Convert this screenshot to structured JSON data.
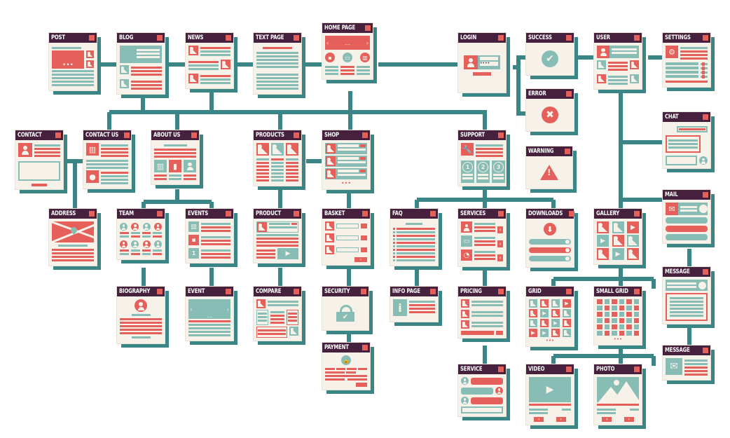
{
  "diagram": {
    "type": "website sitemap",
    "colors": {
      "connector": "#3a8585",
      "titlebar": "#46213d",
      "accent_red": "#e5605a",
      "accent_teal": "#88bdb6",
      "paper": "#f6f2e9"
    },
    "nodes": [
      {
        "id": "post",
        "title": "POST",
        "icon": "image-placeholder-icon"
      },
      {
        "id": "blog",
        "title": "BLOG",
        "icon": "image-placeholder-icon"
      },
      {
        "id": "news",
        "title": "NEWS",
        "icon": "image-placeholder-icon"
      },
      {
        "id": "text-page",
        "title": "TEXT PAGE",
        "icon": "text-lines-icon"
      },
      {
        "id": "home-page",
        "title": "HOME PAGE",
        "icon": "carousel-icon",
        "carousel_dots": "..."
      },
      {
        "id": "login",
        "title": "LOGIN",
        "icon": "user-icon",
        "password_mask": "••••"
      },
      {
        "id": "success",
        "title": "SUCCESS",
        "icon": "checkmark-icon"
      },
      {
        "id": "error",
        "title": "ERROR",
        "icon": "x-icon"
      },
      {
        "id": "user",
        "title": "USER",
        "icon": "user-icon"
      },
      {
        "id": "settings",
        "title": "SETTINGS",
        "icon": "gear-icon"
      },
      {
        "id": "chat",
        "title": "CHAT",
        "icon": "chat-bubble-icon"
      },
      {
        "id": "contact",
        "title": "CONTACT",
        "icon": "user-icon"
      },
      {
        "id": "contact-us",
        "title": "CONTACT US",
        "icon": "building-icon"
      },
      {
        "id": "about-us",
        "title": "ABOUT US",
        "icon": "chart-icon"
      },
      {
        "id": "products",
        "title": "PRODUCTS",
        "icon": "image-placeholder-icon"
      },
      {
        "id": "shop",
        "title": "SHOP",
        "icon": "image-placeholder-icon"
      },
      {
        "id": "support",
        "title": "SUPPORT",
        "icon": "wrench-icon",
        "steps": [
          "1",
          "2",
          "3"
        ]
      },
      {
        "id": "warning",
        "title": "WARNING",
        "icon": "warning-icon"
      },
      {
        "id": "mail",
        "title": "MAIL",
        "icon": "envelope-icon"
      },
      {
        "id": "address",
        "title": "ADDRESS",
        "icon": "map-pin-icon"
      },
      {
        "id": "team",
        "title": "TEAM",
        "icon": "user-icon"
      },
      {
        "id": "events",
        "title": "EVENTS",
        "icon": "calendar-icon",
        "day": "1"
      },
      {
        "id": "product",
        "title": "PRODUCT",
        "icon": "play-icon"
      },
      {
        "id": "basket",
        "title": "BASKET",
        "icon": "image-placeholder-icon"
      },
      {
        "id": "faq",
        "title": "FAQ",
        "icon": "text-lines-icon"
      },
      {
        "id": "services",
        "title": "SERVICES",
        "icon": "monitor-icon"
      },
      {
        "id": "downloads",
        "title": "DOWNLOADS",
        "icon": "download-icon"
      },
      {
        "id": "gallery",
        "title": "GALLERY",
        "icon": "image-placeholder-icon"
      },
      {
        "id": "message-1",
        "title": "MESSAGE",
        "icon": "user-icon"
      },
      {
        "id": "biography",
        "title": "BIOGRAPHY",
        "icon": "user-icon"
      },
      {
        "id": "event",
        "title": "EVENT",
        "icon": "carousel-icon",
        "carousel_dots": "..."
      },
      {
        "id": "compare",
        "title": "COMPARE",
        "icon": "image-placeholder-icon"
      },
      {
        "id": "security",
        "title": "SECURITY",
        "icon": "lock-icon"
      },
      {
        "id": "info-page",
        "title": "INFO PAGE",
        "icon": "info-icon",
        "glyph": "i"
      },
      {
        "id": "pricing",
        "title": "PRICING",
        "icon": "image-placeholder-icon"
      },
      {
        "id": "grid",
        "title": "GRID",
        "icon": "image-placeholder-icon"
      },
      {
        "id": "small-grid",
        "title": "SMALL GRID",
        "icon": "grid-icon"
      },
      {
        "id": "message-2",
        "title": "MESSAGE",
        "icon": "envelope-icon"
      },
      {
        "id": "payment",
        "title": "PAYMENT",
        "icon": "lock-icon"
      },
      {
        "id": "service",
        "title": "SERVICE",
        "icon": "chat-bubble-icon"
      },
      {
        "id": "video",
        "title": "VIDEO",
        "icon": "play-icon"
      },
      {
        "id": "photo",
        "title": "PHOTO",
        "icon": "mountain-icon"
      }
    ],
    "edges": [
      [
        "post",
        "blog"
      ],
      [
        "blog",
        "news"
      ],
      [
        "news",
        "text-page"
      ],
      [
        "text-page",
        "home-page"
      ],
      [
        "home-page",
        "login"
      ],
      [
        "login",
        "success"
      ],
      [
        "login",
        "error"
      ],
      [
        "success",
        "user"
      ],
      [
        "user",
        "settings"
      ],
      [
        "user",
        "chat"
      ],
      [
        "user",
        "mail"
      ],
      [
        "user",
        "gallery"
      ],
      [
        "blog",
        "contact-us"
      ],
      [
        "blog",
        "about-us"
      ],
      [
        "home-page",
        "products"
      ],
      [
        "home-page",
        "shop"
      ],
      [
        "home-page",
        "support"
      ],
      [
        "contact",
        "contact-us"
      ],
      [
        "contact",
        "address"
      ],
      [
        "products",
        "shop"
      ],
      [
        "about-us",
        "team"
      ],
      [
        "about-us",
        "events"
      ],
      [
        "products",
        "product"
      ],
      [
        "shop",
        "basket"
      ],
      [
        "support",
        "faq"
      ],
      [
        "support",
        "services"
      ],
      [
        "support",
        "downloads"
      ],
      [
        "mail",
        "message-1"
      ],
      [
        "message-1",
        "message-2"
      ],
      [
        "team",
        "biography"
      ],
      [
        "events",
        "event"
      ],
      [
        "product",
        "compare"
      ],
      [
        "basket",
        "security"
      ],
      [
        "faq",
        "info-page"
      ],
      [
        "services",
        "pricing"
      ],
      [
        "gallery",
        "grid"
      ],
      [
        "gallery",
        "small-grid"
      ],
      [
        "security",
        "payment"
      ],
      [
        "pricing",
        "service"
      ],
      [
        "gallery",
        "video"
      ],
      [
        "gallery",
        "photo"
      ]
    ]
  }
}
